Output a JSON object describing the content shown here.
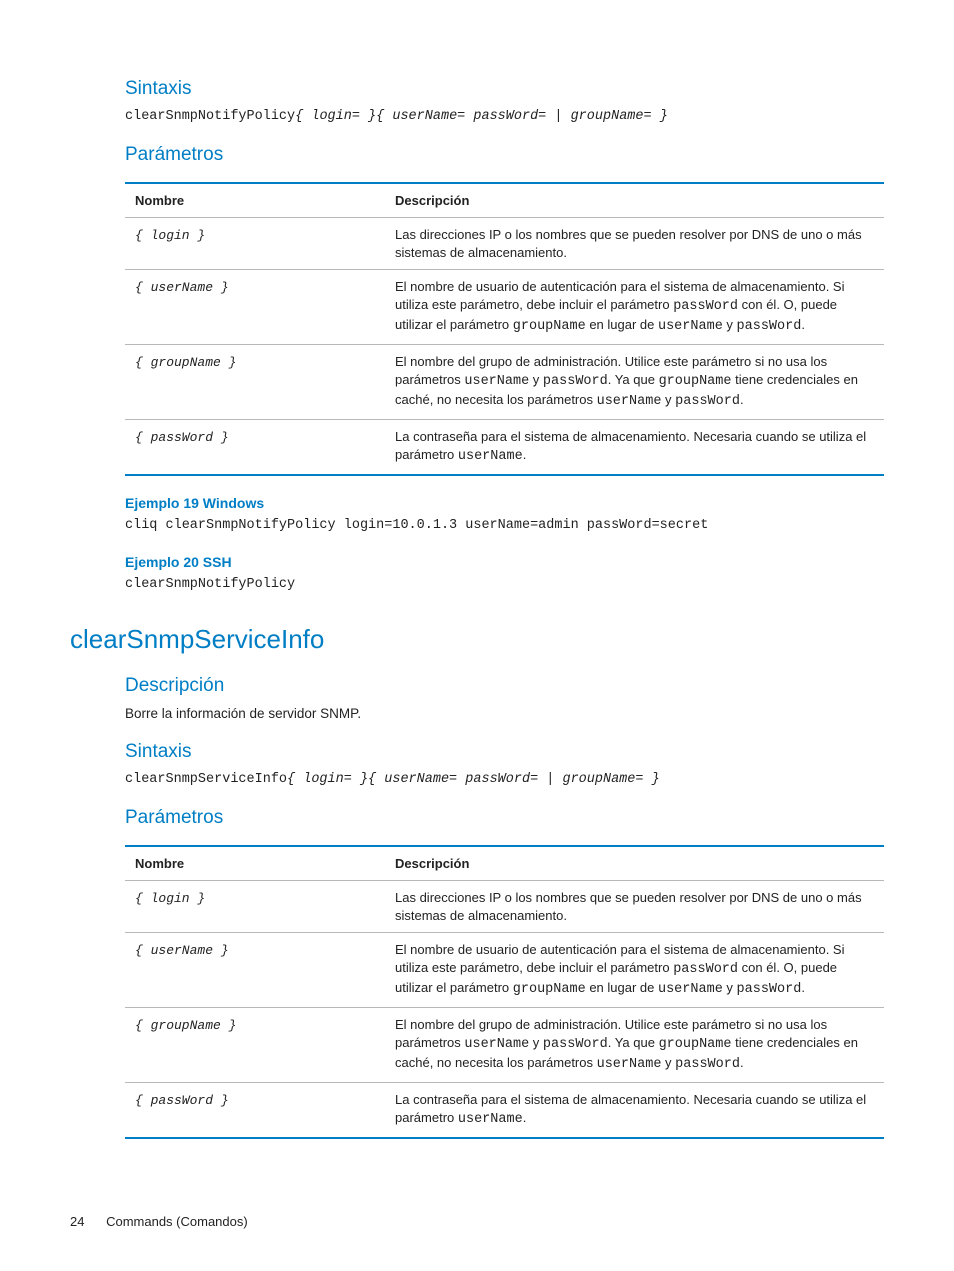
{
  "section1": {
    "sintaxis_heading": "Sintaxis",
    "syntax_cmd": "clearSnmpNotifyPolicy",
    "syntax_opts": "{ login= }{  userName= passWord=  |  groupName= }",
    "parametros_heading": "Parámetros",
    "table": {
      "headers": {
        "name": "Nombre",
        "desc": "Descripción"
      },
      "rows": [
        {
          "name": "{ login }",
          "desc": "Las direcciones IP o los nombres que se pueden resolver por DNS de uno o más sistemas de almacenamiento."
        },
        {
          "name": "{ userName }",
          "desc_html": "El nombre de usuario de autenticación para el sistema de almacenamiento. Si utiliza este parámetro, debe incluir el parámetro <code>passWord</code> con él. O, puede utilizar el parámetro <code>groupName</code> en lugar de <code>userName</code> y <code>passWord</code>."
        },
        {
          "name": "{ groupName }",
          "desc_html": "El nombre del grupo de administración. Utilice este parámetro si no usa los parámetros <code>userName</code> y <code>passWord</code>. Ya que <code>groupName</code> tiene credenciales en caché, no necesita los parámetros <code>userName</code> y <code>passWord</code>."
        },
        {
          "name": "{ passWord }",
          "desc_html": "La contraseña para el sistema de almacenamiento. Necesaria cuando se utiliza el parámetro <code>userName</code>."
        }
      ]
    },
    "example1_heading": "Ejemplo 19 Windows",
    "example1_code": "cliq clearSnmpNotifyPolicy login=10.0.1.3 userName=admin passWord=secret",
    "example2_heading": "Ejemplo 20 SSH",
    "example2_code": "clearSnmpNotifyPolicy"
  },
  "section2": {
    "title": "clearSnmpServiceInfo",
    "desc_heading": "Descripción",
    "desc_text": "Borre la información de servidor SNMP.",
    "sintaxis_heading": "Sintaxis",
    "syntax_cmd": "clearSnmpServiceInfo",
    "syntax_opts": "{ login= }{  userName= passWord=  |  groupName=  }",
    "parametros_heading": "Parámetros",
    "table": {
      "headers": {
        "name": "Nombre",
        "desc": "Descripción"
      },
      "rows": [
        {
          "name": "{ login }",
          "desc": "Las direcciones IP o los nombres que se pueden resolver por DNS de uno o más sistemas de almacenamiento."
        },
        {
          "name": "{ userName }",
          "desc_html": "El nombre de usuario de autenticación para el sistema de almacenamiento. Si utiliza este parámetro, debe incluir el parámetro <code>passWord</code> con él. O, puede utilizar el parámetro <code>groupName</code> en lugar de <code>userName</code> y <code>passWord</code>."
        },
        {
          "name": "{ groupName }",
          "desc_html": "El nombre del grupo de administración. Utilice este parámetro si no usa los parámetros <code>userName</code> y <code>passWord</code>. Ya que <code>groupName</code> tiene credenciales en caché, no necesita los parámetros <code>userName</code> y <code>passWord</code>."
        },
        {
          "name": "{ passWord }",
          "desc_html": "La contraseña para el sistema de almacenamiento. Necesaria cuando se utiliza el parámetro <code>userName</code>."
        }
      ]
    }
  },
  "footer": {
    "page": "24",
    "section": "Commands (Comandos)"
  }
}
